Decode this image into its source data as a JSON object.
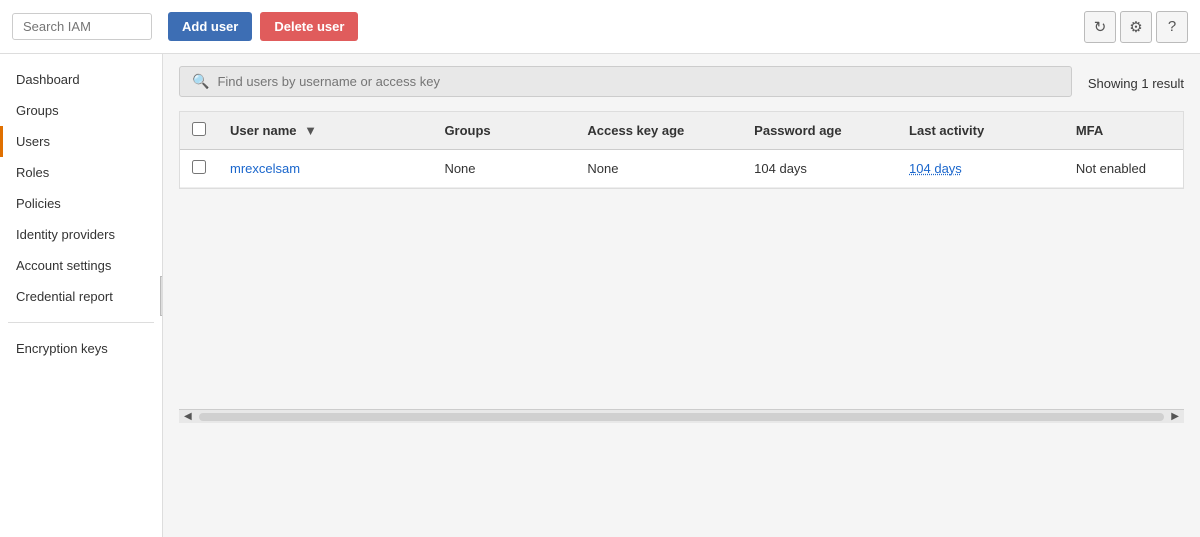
{
  "topbar": {
    "search_placeholder": "Search IAM",
    "add_user_label": "Add user",
    "delete_user_label": "Delete user"
  },
  "icons": {
    "refresh": "↻",
    "settings": "⚙",
    "help": "?",
    "search": "🔍",
    "collapse": "◀"
  },
  "sidebar": {
    "items": [
      {
        "id": "dashboard",
        "label": "Dashboard",
        "active": false
      },
      {
        "id": "groups",
        "label": "Groups",
        "active": false
      },
      {
        "id": "users",
        "label": "Users",
        "active": true
      },
      {
        "id": "roles",
        "label": "Roles",
        "active": false
      },
      {
        "id": "policies",
        "label": "Policies",
        "active": false
      },
      {
        "id": "identity-providers",
        "label": "Identity providers",
        "active": false
      },
      {
        "id": "account-settings",
        "label": "Account settings",
        "active": false
      },
      {
        "id": "credential-report",
        "label": "Credential report",
        "active": false
      }
    ],
    "items2": [
      {
        "id": "encryption-keys",
        "label": "Encryption keys",
        "active": false
      }
    ]
  },
  "content": {
    "search_placeholder": "Find users by username or access key",
    "results_info": "Showing 1 result",
    "table": {
      "columns": [
        {
          "id": "username",
          "label": "User name",
          "sortable": true
        },
        {
          "id": "groups",
          "label": "Groups",
          "sortable": false
        },
        {
          "id": "access_key_age",
          "label": "Access key age",
          "sortable": false
        },
        {
          "id": "password_age",
          "label": "Password age",
          "sortable": false
        },
        {
          "id": "last_activity",
          "label": "Last activity",
          "sortable": false
        },
        {
          "id": "mfa",
          "label": "MFA",
          "sortable": false
        }
      ],
      "rows": [
        {
          "username": "mrexcelsam",
          "groups": "None",
          "access_key_age": "None",
          "password_age": "104 days",
          "last_activity": "104 days",
          "mfa": "Not enabled"
        }
      ]
    }
  }
}
